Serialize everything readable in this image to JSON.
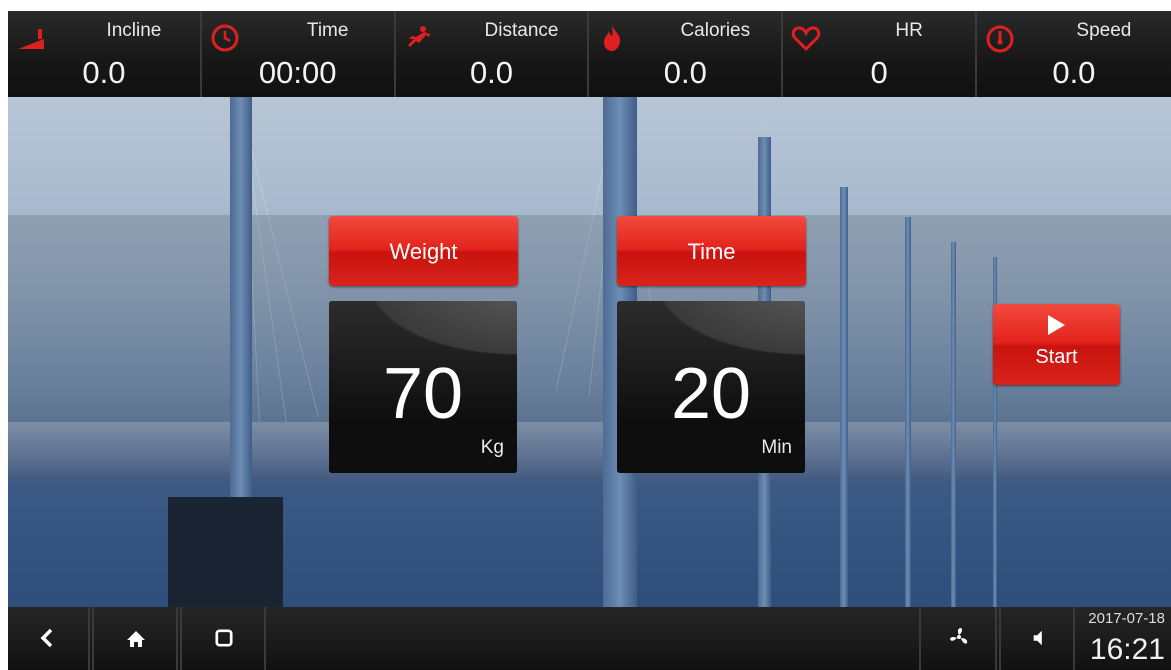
{
  "stats": [
    {
      "label": "Incline",
      "value": "0.0",
      "icon": "incline-icon"
    },
    {
      "label": "Time",
      "value": "00:00",
      "icon": "clock-icon"
    },
    {
      "label": "Distance",
      "value": "0.0",
      "icon": "runner-icon"
    },
    {
      "label": "Calories",
      "value": "0.0",
      "icon": "flame-icon"
    },
    {
      "label": "HR",
      "value": "0",
      "icon": "heart-icon"
    },
    {
      "label": "Speed",
      "value": "0.0",
      "icon": "speedometer-icon"
    }
  ],
  "setup": {
    "weight": {
      "label": "Weight",
      "value": "70",
      "unit": "Kg"
    },
    "time": {
      "label": "Time",
      "value": "20",
      "unit": "Min"
    },
    "start_label": "Start"
  },
  "navbar": {
    "back_icon": "back-chevron-icon",
    "home_icon": "home-icon",
    "recent_icon": "recent-apps-icon",
    "fan_icon": "fan-icon",
    "volume_icon": "volume-icon",
    "date": "2017-07-18",
    "time": "16:21"
  },
  "colors": {
    "accent_red": "#e2231c",
    "icon_red": "#e02020"
  }
}
